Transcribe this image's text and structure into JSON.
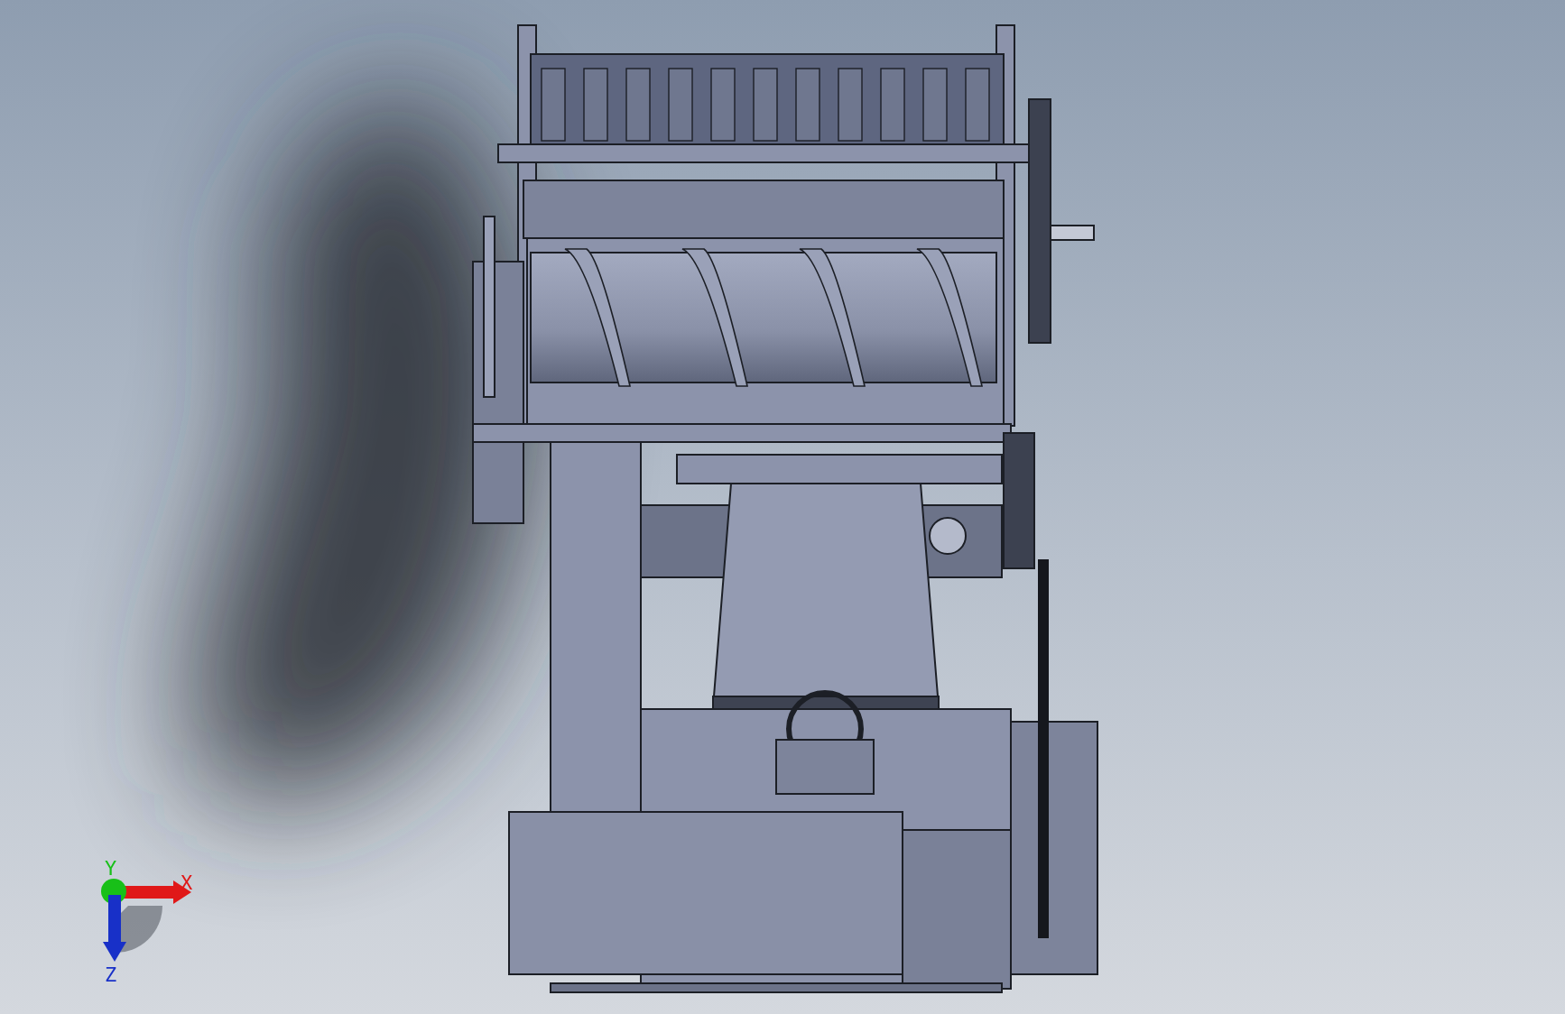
{
  "viewport": {
    "triad": {
      "axes": [
        {
          "label": "X",
          "color": "#e01818",
          "kind": "right"
        },
        {
          "label": "Y",
          "color": "#18c018",
          "kind": "up"
        },
        {
          "label": "Z",
          "color": "#1830c8",
          "kind": "down"
        }
      ]
    }
  }
}
